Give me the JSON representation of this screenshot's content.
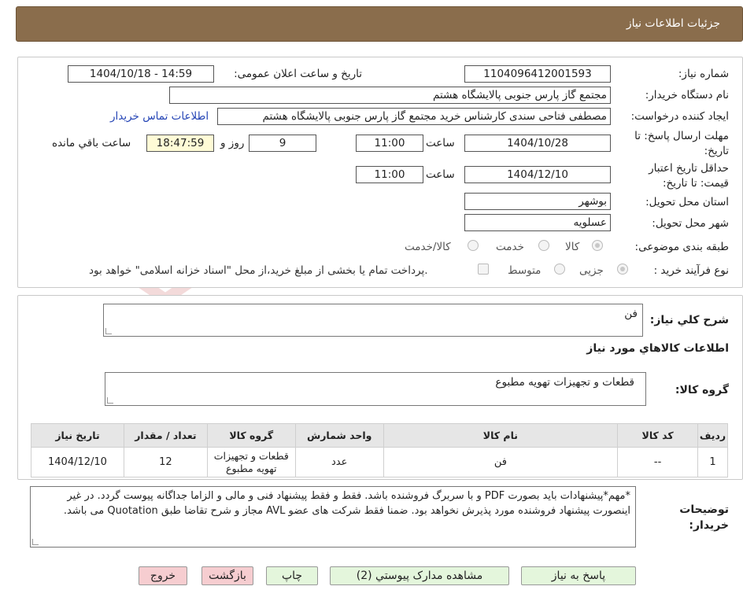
{
  "header": {
    "title": "جزئیات اطلاعات نیاز"
  },
  "details": {
    "need_number_label": "شماره نیاز:",
    "need_number": "1104096412001593",
    "announce_label": "تاریخ و ساعت اعلان عمومی:",
    "announce_value": "1404/10/18 - 14:59",
    "buyer_org_label": "نام دستگاه خریدار:",
    "buyer_org": "مجتمع گاز پارس جنوبی  پالایشگاه هشتم",
    "requester_label": "ایجاد کننده درخواست:",
    "requester": "مصطفی فتاحی سندی کارشناس خرید مجتمع گاز پارس جنوبی  پالایشگاه هشتم",
    "contact_link": "اطلاعات تماس خریدار",
    "deadline_label_1": "مهلت ارسال پاسخ: تا",
    "deadline_label_2": "تاریخ:",
    "deadline_date": "1404/10/28",
    "time_label": "ساعت",
    "deadline_time": "11:00",
    "days_value": "9",
    "days_label": "روز و",
    "remaining_time": "18:47:59",
    "remaining_label": "ساعت باقي مانده",
    "validity_label_1": "حداقل تاریخ اعتبار",
    "validity_label_2": "قیمت: تا تاریخ:",
    "validity_date": "1404/12/10",
    "validity_time": "11:00",
    "province_label": "استان محل تحویل:",
    "province": "بوشهر",
    "city_label": "شهر محل تحویل:",
    "city": "عسلویه",
    "category_label": "طبقه بندی موضوعی:",
    "category_options": [
      "کالا",
      "خدمت",
      "کالا/خدمت"
    ],
    "category_selected": "کالا",
    "process_label": "نوع فرآیند خرید :",
    "process_options": [
      "جزیی",
      "متوسط"
    ],
    "process_selected": "جزیی",
    "payment_note": "پرداخت تمام یا بخشی از مبلغ خرید،از محل \"اسناد خزانه اسلامی\" خواهد بود."
  },
  "summary": {
    "general_desc_label": "شرح کلي نياز:",
    "general_desc": "فن",
    "goods_info_heading": "اطلاعات کالاهاي مورد نياز",
    "goods_group_label": "گروه کالا:",
    "goods_group": "قطعات و تجهیزات تهویه مطبوع"
  },
  "table": {
    "headers": [
      "رديف",
      "کد کالا",
      "نام کالا",
      "واحد شمارش",
      "گروه کالا",
      "تعداد / مقدار",
      "تاريخ نياز"
    ],
    "rows": [
      [
        "1",
        "--",
        "فن",
        "عدد",
        "قطعات و تجهیزات تهویه مطبوع",
        "12",
        "1404/12/10"
      ]
    ]
  },
  "notes": {
    "label": "توضیحات خریدار:",
    "text": "*مهم*پیشنهادات باید بصورت PDF و با سربرگ فروشنده باشد. فقط و فقط پیشنهاد فنی و مالی و الزاما جداگانه پیوست گردد. در غیر اینصورت پیشنهاد فروشنده مورد پذیرش نخواهد بود. ضمنا فقط شرکت های عضو AVL مجاز و شرح تقاضا طبق Quotation می باشد."
  },
  "buttons": {
    "reply": "پاسخ به نیاز",
    "attachments": "مشاهده مدارک پیوستي (2)",
    "print": "چاپ",
    "back": "بازگشت",
    "exit": "خروج"
  },
  "watermark": {
    "text": "AriaTender.neT"
  },
  "colors": {
    "header_bg": "#8a6d4c",
    "link": "#2444b5",
    "time_bg": "#fffbd6",
    "btn_green": "#e4f6dc",
    "btn_red": "#f6cdd0"
  }
}
